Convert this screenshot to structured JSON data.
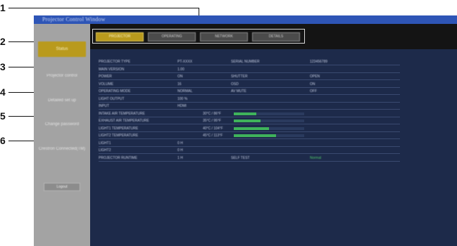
{
  "callouts": [
    "1",
    "2",
    "3",
    "4",
    "5",
    "6"
  ],
  "window": {
    "title": "Projector Control Window"
  },
  "tabs": [
    {
      "label": "PROJECTOR",
      "active": true
    },
    {
      "label": "OPERATING",
      "active": false
    },
    {
      "label": "NETWORK",
      "active": false
    },
    {
      "label": "DETAILS",
      "active": false
    }
  ],
  "sidebar": {
    "items": [
      {
        "label": "Status",
        "active": true
      },
      {
        "label": "Projector control",
        "active": false
      },
      {
        "label": "Detailed set up",
        "active": false
      },
      {
        "label": "Change password",
        "active": false
      },
      {
        "label": "Crestron Connected(TM)",
        "active": false
      }
    ],
    "bottom_button": "Logout"
  },
  "status": {
    "rows": [
      {
        "label": "PROJECTOR TYPE",
        "value": "PT-XXXX",
        "label2": "SERIAL NUMBER",
        "value2": "123456789"
      },
      {
        "label": "MAIN VERSION",
        "value": "1.00",
        "label2": "",
        "value2": ""
      },
      {
        "label": "POWER",
        "value": "ON",
        "label2": "SHUTTER",
        "value2": "OPEN"
      },
      {
        "label": "VOLUME",
        "value": "16",
        "label2": "OSD",
        "value2": "ON"
      },
      {
        "label": "OPERATING MODE",
        "value": "NORMAL",
        "label2": "AV MUTE",
        "value2": "OFF"
      },
      {
        "label": "LIGHT OUTPUT",
        "value": "100 %",
        "label2": "",
        "value2": ""
      },
      {
        "label": "INPUT",
        "value": "HDMI",
        "label2": "",
        "value2": ""
      },
      {
        "label": "INTAKE AIR TEMPERATURE",
        "value": "30°C / 86°F",
        "bar": 0.32
      },
      {
        "label": "EXHAUST AIR TEMPERATURE",
        "value": "35°C / 95°F",
        "bar": 0.38
      },
      {
        "label": "LIGHT1 TEMPERATURE",
        "value": "40°C / 104°F",
        "bar": 0.5
      },
      {
        "label": "LIGHT2 TEMPERATURE",
        "value": "45°C / 113°F",
        "bar": 0.6
      },
      {
        "label": "LIGHT1",
        "value": "0 H",
        "label2": "",
        "value2": ""
      },
      {
        "label": "LIGHT2",
        "value": "0 H",
        "label2": "",
        "value2": ""
      },
      {
        "label": "PROJECTOR RUNTIME",
        "value": "1 H",
        "label2": "SELF TEST",
        "value2": "Normal"
      }
    ]
  },
  "colors": {
    "active_tab": "#b99a1d",
    "content_bg": "#1d2a4a",
    "bar_fill": "#3fb35b"
  }
}
